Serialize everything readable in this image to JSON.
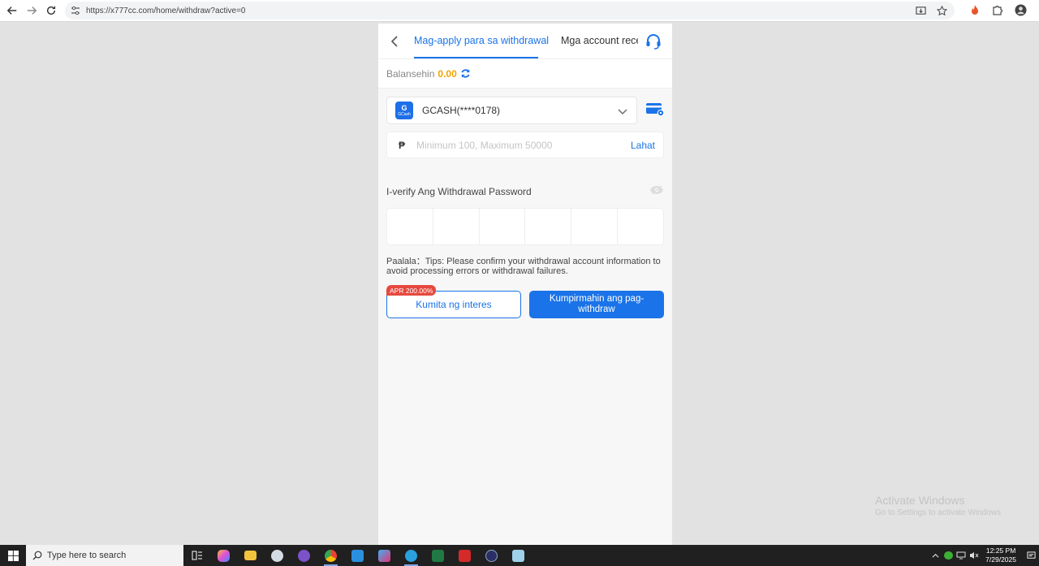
{
  "browser": {
    "url": "https://x777cc.com/home/withdraw?active=0"
  },
  "tabs": {
    "apply": "Mag-apply para sa withdrawal",
    "accounts": "Mga account recei"
  },
  "balance": {
    "label": "Balansehin",
    "value": "0.00"
  },
  "account": {
    "logo_top": "G",
    "logo_bottom": "GCash",
    "name": "GCASH(****0178)"
  },
  "amount": {
    "currency": "₱",
    "placeholder": "Minimum 100, Maximum 50000",
    "all_label": "Lahat"
  },
  "verify": {
    "label": "I-verify Ang Withdrawal Password",
    "boxes": [
      "",
      "",
      "",
      "",
      "",
      ""
    ]
  },
  "tips": {
    "text": "Paalala：Tips: Please confirm your withdrawal account information to avoid processing errors or withdrawal failures."
  },
  "buttons": {
    "apr_badge": "APR 200.00%",
    "earn": "Kumita ng interes",
    "confirm": "Kumpirmahin ang pag-withdraw"
  },
  "watermark": {
    "line1": "Activate Windows",
    "line2": "Go to Settings to activate Windows"
  },
  "taskbar": {
    "search_placeholder": "Type here to search",
    "time": "12:25 PM",
    "date": "7/29/2025"
  },
  "colors": {
    "accent": "#1a73e8",
    "balance": "#f0a500",
    "badge": "#e6493e"
  }
}
